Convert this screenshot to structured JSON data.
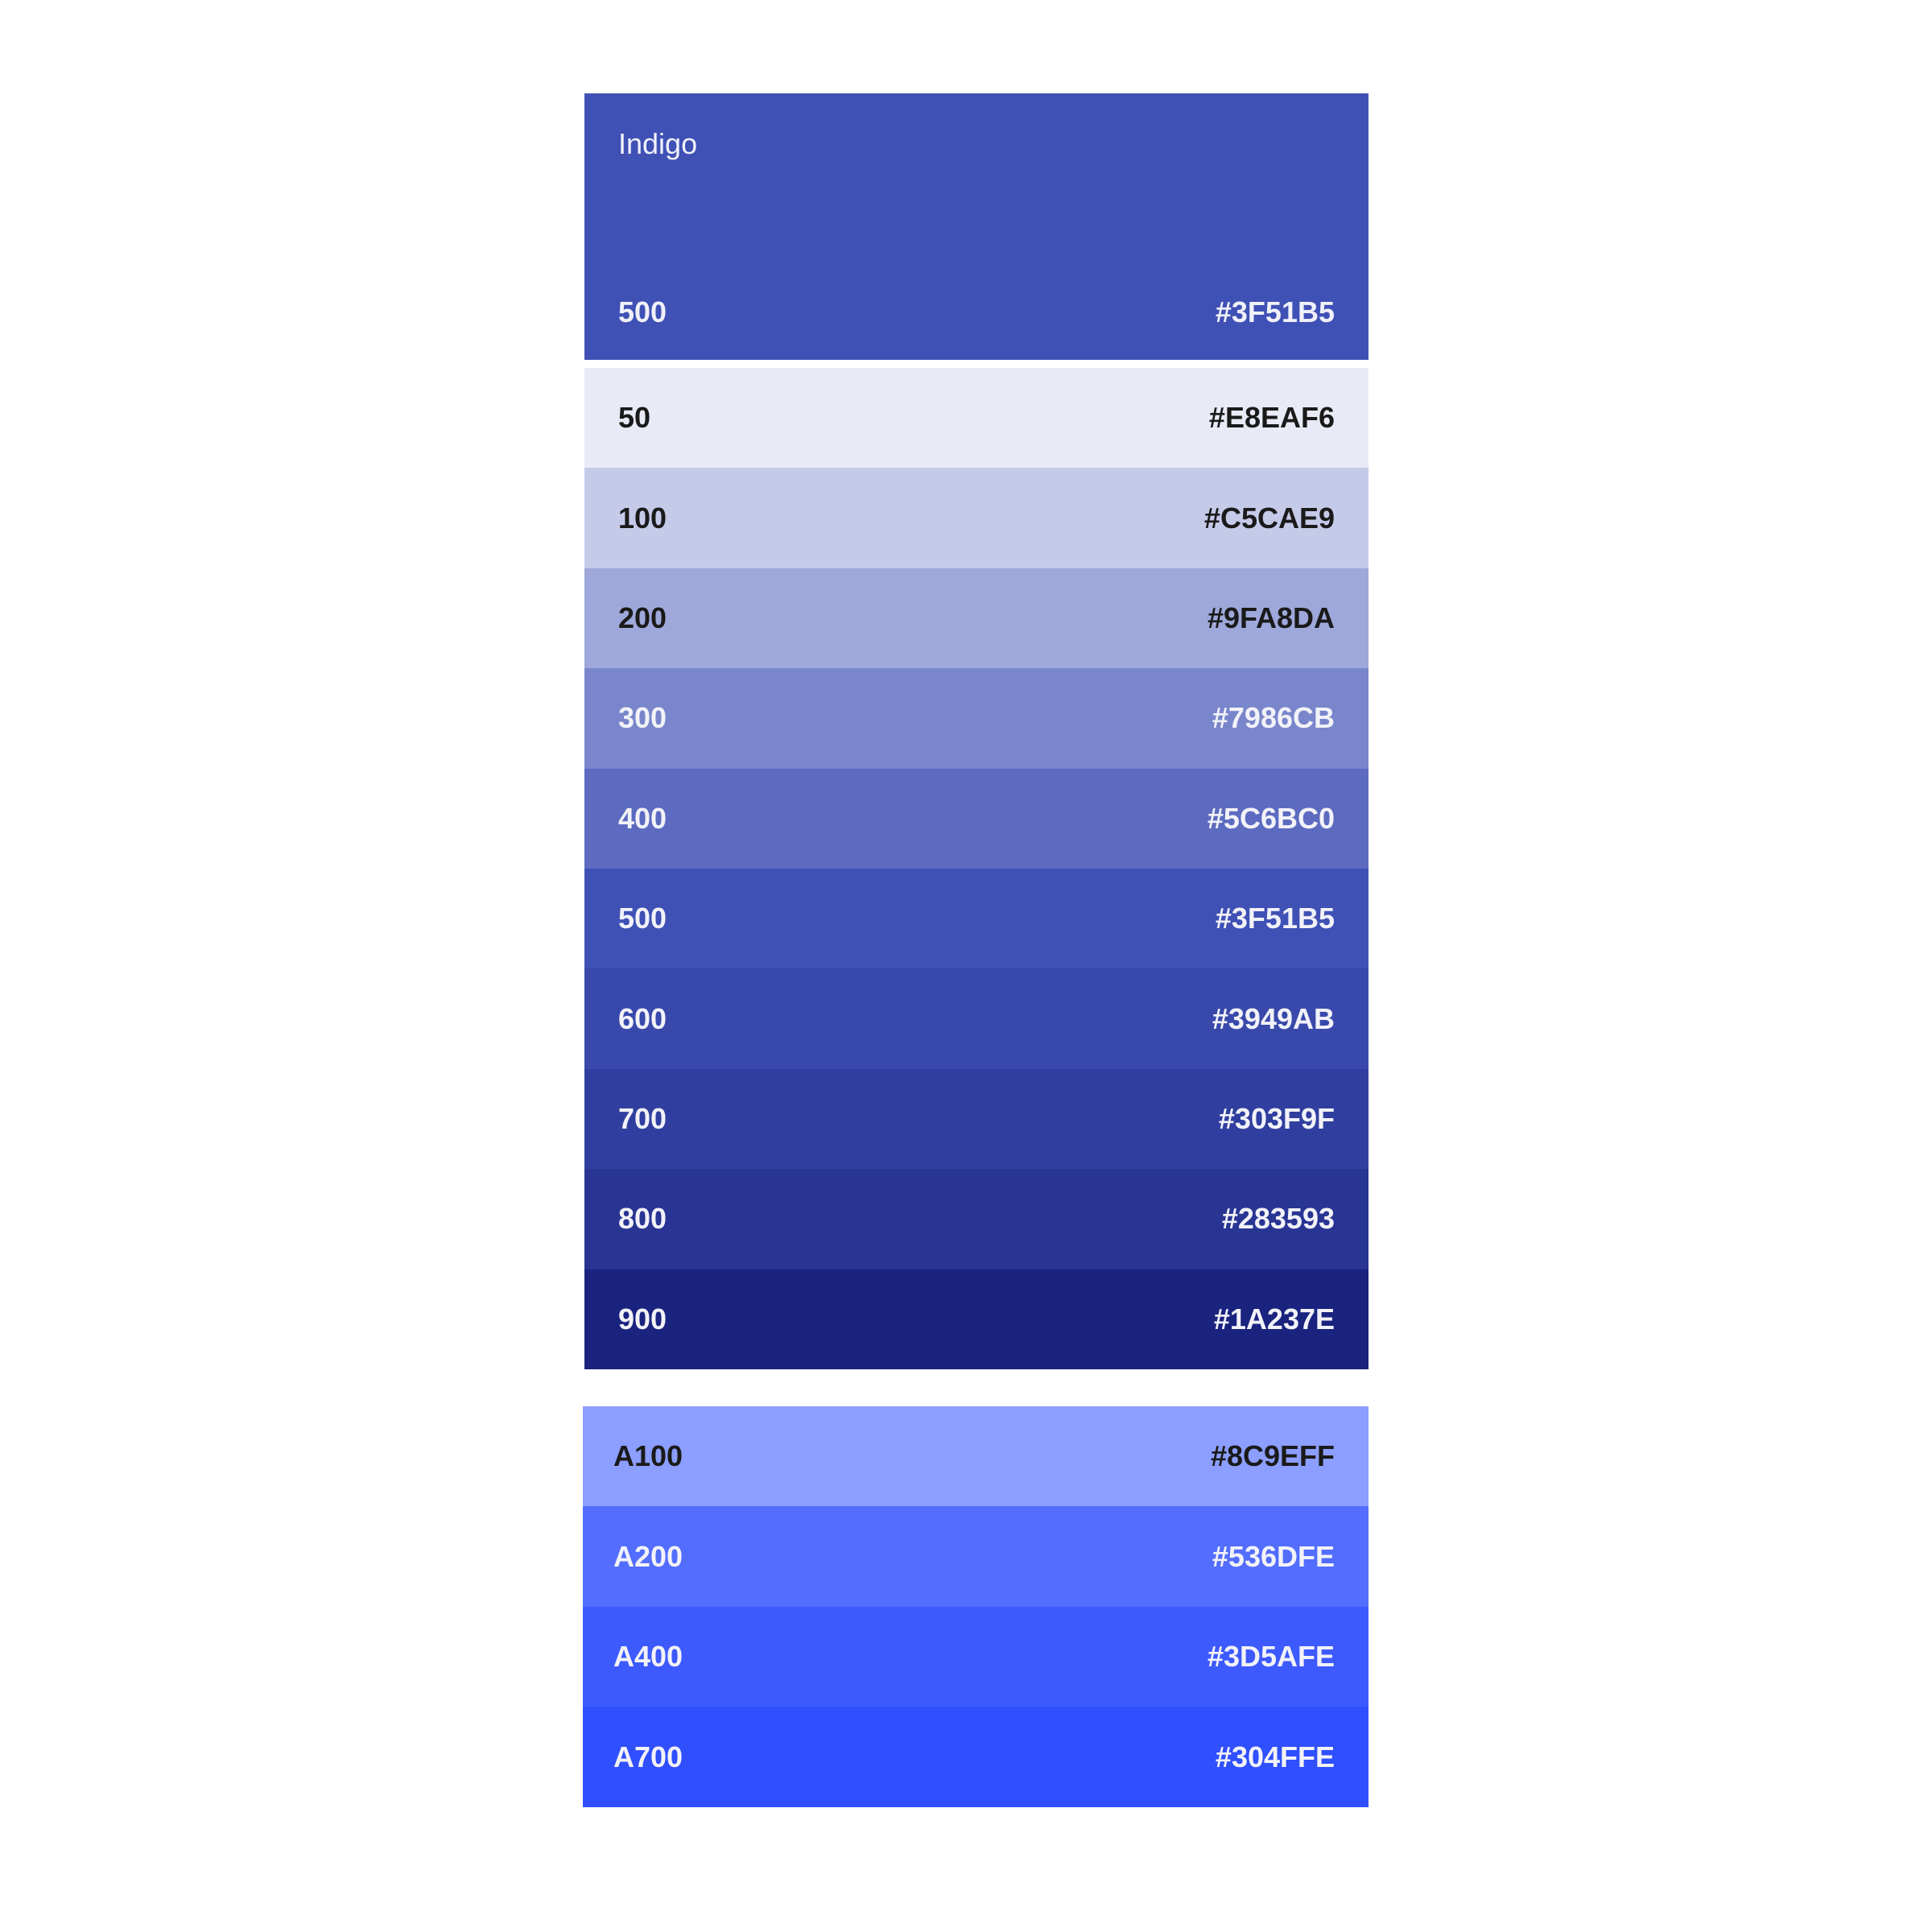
{
  "header": {
    "name": "Indigo",
    "shade": "500",
    "hex": "#3F51B5",
    "color": "#3F51B5"
  },
  "swatches": [
    {
      "shade": "50",
      "hex": "#E8EAF6",
      "color": "#E8EAF6",
      "text_color": "#1A1A1A"
    },
    {
      "shade": "100",
      "hex": "#C5CAE9",
      "color": "#C5CAE9",
      "text_color": "#1A1A1A"
    },
    {
      "shade": "200",
      "hex": "#9FA8DA",
      "color": "#9FA8DA",
      "text_color": "#1A1A1A"
    },
    {
      "shade": "300",
      "hex": "#7986CB",
      "color": "#7986CB",
      "text_color": "#F2F2F8"
    },
    {
      "shade": "400",
      "hex": "#5C6BC0",
      "color": "#5C6BC0",
      "text_color": "#F2F2F8"
    },
    {
      "shade": "500",
      "hex": "#3F51B5",
      "color": "#3F51B5",
      "text_color": "#F2F2F8"
    },
    {
      "shade": "600",
      "hex": "#3949AB",
      "color": "#3949AB",
      "text_color": "#F2F2F8"
    },
    {
      "shade": "700",
      "hex": "#303F9F",
      "color": "#303F9F",
      "text_color": "#F2F2F8"
    },
    {
      "shade": "800",
      "hex": "#283593",
      "color": "#283593",
      "text_color": "#F2F2F8"
    },
    {
      "shade": "900",
      "hex": "#1A237E",
      "color": "#1A237E",
      "text_color": "#F2F2F8"
    }
  ],
  "accents": [
    {
      "shade": "A100",
      "hex": "#8C9EFF",
      "color": "#8C9EFF",
      "text_color": "#1A1A1A"
    },
    {
      "shade": "A200",
      "hex": "#536DFE",
      "color": "#536DFE",
      "text_color": "#F2F2F8"
    },
    {
      "shade": "A400",
      "hex": "#3D5AFE",
      "color": "#3D5AFE",
      "text_color": "#F2F2F8"
    },
    {
      "shade": "A700",
      "hex": "#304FFE",
      "color": "#304FFE",
      "text_color": "#F2F2F8"
    }
  ]
}
